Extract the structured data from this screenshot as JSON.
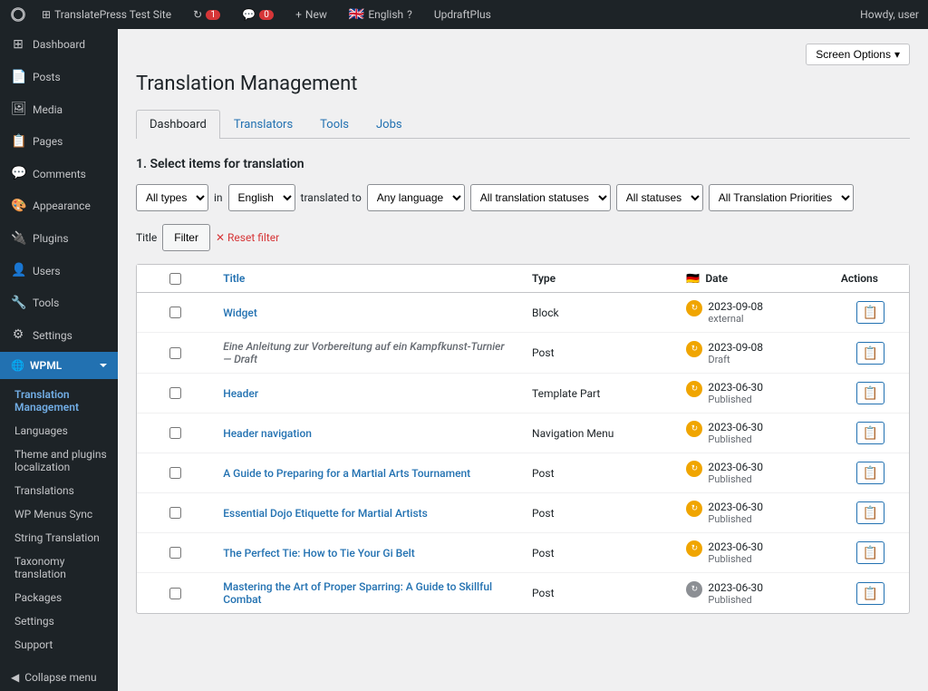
{
  "adminbar": {
    "logo_alt": "WordPress",
    "site_name": "TranslatePress Test Site",
    "updates_count": "1",
    "comments_count": "0",
    "new_label": "New",
    "language": "English",
    "plugin": "UpdraftPlus",
    "howdy": "Howdy, user",
    "screen_options": "Screen Options"
  },
  "sidebar": {
    "items": [
      {
        "id": "dashboard",
        "label": "Dashboard",
        "icon": "⊞"
      },
      {
        "id": "posts",
        "label": "Posts",
        "icon": "📄"
      },
      {
        "id": "media",
        "label": "Media",
        "icon": "🖼"
      },
      {
        "id": "pages",
        "label": "Pages",
        "icon": "📋"
      },
      {
        "id": "comments",
        "label": "Comments",
        "icon": "💬"
      },
      {
        "id": "appearance",
        "label": "Appearance",
        "icon": "🎨"
      },
      {
        "id": "plugins",
        "label": "Plugins",
        "icon": "🔌"
      },
      {
        "id": "users",
        "label": "Users",
        "icon": "👤"
      },
      {
        "id": "tools",
        "label": "Tools",
        "icon": "🔧"
      },
      {
        "id": "settings",
        "label": "Settings",
        "icon": "⚙"
      }
    ],
    "wpml": {
      "label": "WPML",
      "active_item": "Translation Management",
      "subitems": [
        {
          "id": "translation-management",
          "label": "Translation Management",
          "active": true
        },
        {
          "id": "languages",
          "label": "Languages"
        },
        {
          "id": "theme-plugins",
          "label": "Theme and plugins localization"
        },
        {
          "id": "translations",
          "label": "Translations"
        },
        {
          "id": "wp-menus-sync",
          "label": "WP Menus Sync"
        },
        {
          "id": "string-translation",
          "label": "String Translation"
        },
        {
          "id": "taxonomy-translation",
          "label": "Taxonomy translation"
        },
        {
          "id": "packages",
          "label": "Packages"
        },
        {
          "id": "settings",
          "label": "Settings"
        },
        {
          "id": "support",
          "label": "Support"
        }
      ]
    },
    "collapse_label": "Collapse menu"
  },
  "page": {
    "title": "Translation Management",
    "tabs": [
      {
        "id": "dashboard",
        "label": "Dashboard",
        "active": true
      },
      {
        "id": "translators",
        "label": "Translators"
      },
      {
        "id": "tools",
        "label": "Tools"
      },
      {
        "id": "jobs",
        "label": "Jobs"
      }
    ],
    "section_title": "1. Select items for translation",
    "filters": {
      "type_label": "All types",
      "in_label": "in",
      "language_label": "English",
      "translated_to_label": "translated to",
      "any_language_label": "Any language",
      "all_statuses_label": "All translation statuses",
      "statuses_label": "All statuses",
      "priorities_label": "All Translation Priorities",
      "filter_btn": "Filter",
      "reset_label": "Reset filter"
    },
    "table": {
      "col_title": "Title",
      "col_type": "Type",
      "col_flag": "🇩🇪",
      "col_date": "Date",
      "col_actions": "Actions",
      "rows": [
        {
          "id": 1,
          "title": "Widget",
          "type": "Block",
          "date": "2023-09-08",
          "date_status": "external",
          "status": "orange"
        },
        {
          "id": 2,
          "title": "Eine Anleitung zur Vorbereitung auf ein Kampfkunst-Turnier — Draft",
          "type": "Post",
          "date": "2023-09-08",
          "date_status": "Draft",
          "status": "orange",
          "is_draft": true
        },
        {
          "id": 3,
          "title": "Header",
          "type": "Template Part",
          "date": "2023-06-30",
          "date_status": "Published",
          "status": "orange"
        },
        {
          "id": 4,
          "title": "Header navigation",
          "type": "Navigation Menu",
          "date": "2023-06-30",
          "date_status": "Published",
          "status": "orange"
        },
        {
          "id": 5,
          "title": "A Guide to Preparing for a Martial Arts Tournament",
          "type": "Post",
          "date": "2023-06-30",
          "date_status": "Published",
          "status": "orange"
        },
        {
          "id": 6,
          "title": "Essential Dojo Etiquette for Martial Artists",
          "type": "Post",
          "date": "2023-06-30",
          "date_status": "Published",
          "status": "orange"
        },
        {
          "id": 7,
          "title": "The Perfect Tie: How to Tie Your Gi Belt",
          "type": "Post",
          "date": "2023-06-30",
          "date_status": "Published",
          "status": "orange"
        },
        {
          "id": 8,
          "title": "Mastering the Art of Proper Sparring: A Guide to Skillful Combat",
          "type": "Post",
          "date": "2023-06-30",
          "date_status": "Published",
          "status": "gray"
        }
      ]
    }
  }
}
